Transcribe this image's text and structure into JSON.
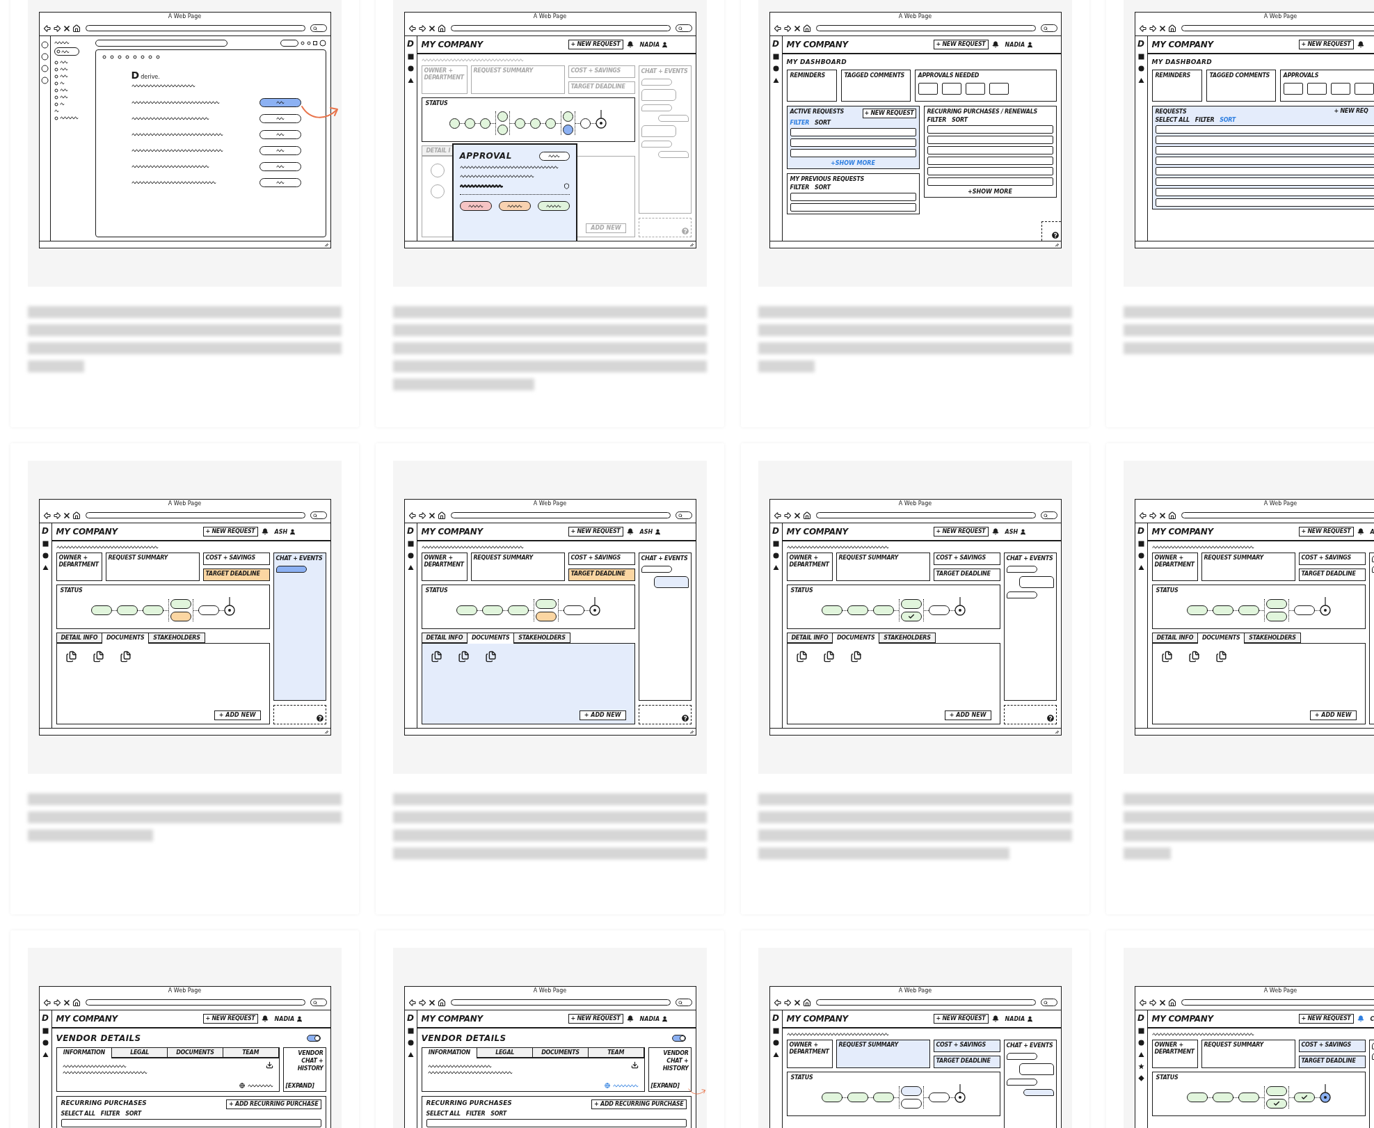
{
  "cards": [
    {
      "arrow": true,
      "wireframe": {
        "kind": "form",
        "page_title": "A Web Page",
        "logo_mark": "D",
        "logo_text": "derive.",
        "rows": [
          {
            "selected": true
          },
          {
            "selected": false
          },
          {
            "selected": false
          },
          {
            "selected": false
          },
          {
            "selected": false
          },
          {
            "selected": false
          }
        ]
      }
    },
    {
      "arrow": false,
      "wireframe": {
        "kind": "request",
        "page_title": "A Web Page",
        "app": {
          "logo": "D",
          "nav": [
            {
              "kind": "square"
            },
            {
              "kind": "circle"
            },
            {
              "kind": "triangle"
            }
          ],
          "company": "MY COMPANY",
          "new_request": "+ NEW REQUEST",
          "bell_active": false,
          "user": "NADIA"
        },
        "dimmed": true,
        "boxes": [
          {
            "kind": "owner",
            "label": "OWNER + DEPARTMENT",
            "color": "#ffffff"
          },
          {
            "kind": "summary",
            "label": "REQUEST SUMMARY",
            "color": "#ffffff"
          },
          {
            "kind": "cost",
            "label": "COST + SAVINGS",
            "color": "#ffffff"
          },
          {
            "kind": "target",
            "label": "TARGET DEADLINE",
            "color": "#ffffff"
          }
        ],
        "chat": {
          "label": "CHAT + EVENTS",
          "highlighted": false,
          "bubbles": [
            {
              "kind": "small",
              "right": false,
              "color": "#ffffff"
            },
            {
              "kind": "large",
              "right": false,
              "color": "#ffffff"
            },
            {
              "kind": "small",
              "right": false,
              "color": "#ffffff"
            },
            {
              "kind": "small",
              "right": true,
              "color": "#ffffff"
            },
            {
              "kind": "large",
              "right": false,
              "color": "#ffffff"
            },
            {
              "kind": "small",
              "right": false,
              "color": "#ffffff"
            },
            {
              "kind": "small",
              "right": true,
              "color": "#ffffff"
            }
          ]
        },
        "status": {
          "label": "STATUS",
          "kind": "circle",
          "steps": [
            {
              "nodes": [
                {
                  "kind": "done"
                }
              ]
            },
            {
              "nodes": [
                {
                  "kind": "done"
                }
              ]
            },
            {
              "nodes": [
                {
                  "kind": "done"
                }
              ]
            },
            {
              "nodes": [
                {
                  "kind": "done"
                },
                {
                  "kind": "done"
                }
              ]
            },
            {
              "nodes": [
                {
                  "kind": "done"
                }
              ]
            },
            {
              "nodes": [
                {
                  "kind": "done"
                }
              ]
            },
            {
              "nodes": [
                {
                  "kind": "done"
                }
              ]
            },
            {
              "nodes": [
                {
                  "kind": "done"
                },
                {
                  "kind": "active"
                }
              ]
            },
            {
              "nodes": [
                {
                  "kind": "todo"
                }
              ]
            }
          ],
          "final": {
            "active": false
          }
        },
        "lower": {
          "kind": "people",
          "highlighted": false,
          "tabs": [
            {
              "label": "DETAIL I",
              "selected": false
            }
          ],
          "add_button": "ADD NEW"
        },
        "help": true,
        "popup": {
          "title": "APPROVAL",
          "buttons": [
            {
              "color": "#f6c4c4"
            },
            {
              "color": "#f8d2b0"
            },
            {
              "color": "#e0f3dc"
            }
          ]
        }
      }
    },
    {
      "arrow": false,
      "wireframe": {
        "kind": "dashboard",
        "page_title": "A Web Page",
        "app": {
          "logo": "D",
          "nav": [
            {
              "kind": "square"
            },
            {
              "kind": "circle"
            },
            {
              "kind": "triangle"
            }
          ],
          "company": "MY COMPANY",
          "new_request": "+ NEW REQUEST",
          "bell_active": false,
          "user": "NADIA"
        },
        "title": "MY DASHBOARD",
        "tiles": [
          {
            "kind": "text",
            "label": "REMINDERS"
          },
          {
            "kind": "text",
            "label": "TAGGED COMMENTS"
          },
          {
            "kind": "slots",
            "label": "APPROVALS NEEDED"
          }
        ],
        "columns": [
          {
            "panels": [
              {
                "title": "ACTIVE REQUESTS",
                "highlight": true,
                "button": {
                  "label": "+ NEW REQUEST",
                  "outlined": true
                },
                "links": [
                  {
                    "label": "FILTER",
                    "active": true
                  },
                  {
                    "label": "SORT",
                    "active": false
                  }
                ],
                "kind": "medium",
                "show_more": "+SHOW MORE"
              },
              {
                "title": "MY PREVIOUS REQUESTS",
                "highlight": false,
                "links": [
                  {
                    "label": "FILTER",
                    "active": false
                  },
                  {
                    "label": "SORT",
                    "active": false
                  }
                ],
                "kind": "small"
              }
            ]
          },
          {
            "panels": [
              {
                "title": "RECURRING PURCHASES / RENEWALS",
                "highlight": false,
                "links": [
                  {
                    "label": "FILTER",
                    "active": false
                  },
                  {
                    "label": "SORT",
                    "active": false
                  }
                ],
                "kind": "large",
                "show_more": "+SHOW MORE"
              }
            ]
          }
        ],
        "help": true
      }
    },
    {
      "arrow": false,
      "wireframe": {
        "kind": "dashboard",
        "page_title": "A Web Page",
        "app": {
          "logo": "D",
          "nav": [
            {
              "kind": "square"
            },
            {
              "kind": "circle"
            },
            {
              "kind": "triangle"
            }
          ],
          "company": "MY COMPANY",
          "new_request": "+ NEW REQUEST",
          "bell_active": false
        },
        "title": "MY DASHBOARD",
        "tiles": [
          {
            "kind": "text",
            "label": "REMINDERS"
          },
          {
            "kind": "text",
            "label": "TAGGED COMMENTS"
          },
          {
            "kind": "slots",
            "label": "APPROVALS"
          }
        ],
        "columns": [
          {
            "panels": [
              {
                "title": "REQUESTS",
                "highlight": true,
                "button": {
                  "label": "+ NEW REQ",
                  "outlined": false
                },
                "links": [
                  {
                    "label": "SELECT ALL",
                    "active": false
                  },
                  {
                    "label": "FILTER",
                    "active": false
                  },
                  {
                    "label": "SORT",
                    "active": true
                  }
                ],
                "kind": "full"
              }
            ]
          }
        ],
        "help": false
      }
    },
    {
      "arrow": false,
      "wireframe": {
        "kind": "request",
        "page_title": "A Web Page",
        "app": {
          "logo": "D",
          "nav": [
            {
              "kind": "square"
            },
            {
              "kind": "circle"
            },
            {
              "kind": "triangle"
            }
          ],
          "company": "MY COMPANY",
          "new_request": "+ NEW REQUEST",
          "bell_active": false,
          "user": "ASH"
        },
        "dimmed": false,
        "boxes": [
          {
            "kind": "owner",
            "label": "OWNER + DEPARTMENT",
            "color": "#ffffff"
          },
          {
            "kind": "summary",
            "label": "REQUEST SUMMARY",
            "color": "#ffffff"
          },
          {
            "kind": "cost",
            "label": "COST + SAVINGS",
            "color": "#ffffff"
          },
          {
            "kind": "target",
            "label": "TARGET DEADLINE",
            "color": "#fbd6a2"
          }
        ],
        "chat": {
          "label": "CHAT + EVENTS",
          "highlighted": true,
          "bubbles": [
            {
              "kind": "small",
              "right": false,
              "color": "#8cb1f3"
            }
          ]
        },
        "status": {
          "label": "STATUS",
          "kind": "pill",
          "steps": [
            {
              "nodes": [
                {
                  "kind": "done"
                }
              ]
            },
            {
              "nodes": [
                {
                  "kind": "done"
                }
              ]
            },
            {
              "nodes": [
                {
                  "kind": "done"
                }
              ]
            },
            {
              "nodes": [
                {
                  "kind": "done"
                },
                {
                  "kind": "warning"
                }
              ]
            },
            {
              "nodes": [
                {
                  "kind": "todo"
                }
              ]
            }
          ],
          "final": {
            "active": false
          }
        },
        "lower": {
          "kind": "documents",
          "highlighted": false,
          "tabs": [
            {
              "label": "DETAIL INFO",
              "selected": false
            },
            {
              "label": "DOCUMENTS",
              "selected": true
            },
            {
              "label": "STAKEHOLDERS",
              "selected": false
            }
          ],
          "add_button": "+ ADD NEW"
        },
        "help": true
      }
    },
    {
      "arrow": false,
      "wireframe": {
        "kind": "request",
        "page_title": "A Web Page",
        "app": {
          "logo": "D",
          "nav": [
            {
              "kind": "square"
            },
            {
              "kind": "circle"
            },
            {
              "kind": "triangle"
            }
          ],
          "company": "MY COMPANY",
          "new_request": "+ NEW REQUEST",
          "bell_active": false,
          "user": "ASH"
        },
        "dimmed": false,
        "boxes": [
          {
            "kind": "owner",
            "label": "OWNER + DEPARTMENT",
            "color": "#ffffff"
          },
          {
            "kind": "summary",
            "label": "REQUEST SUMMARY",
            "color": "#ffffff"
          },
          {
            "kind": "cost",
            "label": "COST + SAVINGS",
            "color": "#ffffff"
          },
          {
            "kind": "target",
            "label": "TARGET DEADLINE",
            "color": "#fbd6a2"
          }
        ],
        "chat": {
          "label": "CHAT + EVENTS",
          "highlighted": false,
          "bubbles": [
            {
              "kind": "small",
              "right": false,
              "color": "#ffffff"
            },
            {
              "kind": "large",
              "right": true,
              "color": "#e4ecfb"
            }
          ]
        },
        "status": {
          "label": "STATUS",
          "kind": "pill",
          "steps": [
            {
              "nodes": [
                {
                  "kind": "done"
                }
              ]
            },
            {
              "nodes": [
                {
                  "kind": "done"
                }
              ]
            },
            {
              "nodes": [
                {
                  "kind": "done"
                }
              ]
            },
            {
              "nodes": [
                {
                  "kind": "done"
                },
                {
                  "kind": "warning"
                }
              ]
            },
            {
              "nodes": [
                {
                  "kind": "todo"
                }
              ]
            }
          ],
          "final": {
            "active": false
          }
        },
        "lower": {
          "kind": "documents",
          "highlighted": true,
          "tabs": [
            {
              "label": "DETAIL INFO",
              "selected": false
            },
            {
              "label": "DOCUMENTS",
              "selected": true
            },
            {
              "label": "STAKEHOLDERS",
              "selected": false
            }
          ],
          "add_button": "+ ADD NEW"
        },
        "help": true
      }
    },
    {
      "arrow": false,
      "wireframe": {
        "kind": "request",
        "page_title": "A Web Page",
        "app": {
          "logo": "D",
          "nav": [
            {
              "kind": "square"
            },
            {
              "kind": "circle"
            },
            {
              "kind": "triangle"
            }
          ],
          "company": "MY COMPANY",
          "new_request": "+ NEW REQUEST",
          "bell_active": false,
          "user": "ASH"
        },
        "dimmed": false,
        "boxes": [
          {
            "kind": "owner",
            "label": "OWNER + DEPARTMENT",
            "color": "#ffffff"
          },
          {
            "kind": "summary",
            "label": "REQUEST SUMMARY",
            "color": "#ffffff"
          },
          {
            "kind": "cost",
            "label": "COST + SAVINGS",
            "color": "#ffffff"
          },
          {
            "kind": "target",
            "label": "TARGET DEADLINE",
            "color": "#ffffff"
          }
        ],
        "chat": {
          "label": "CHAT + EVENTS",
          "highlighted": false,
          "bubbles": [
            {
              "kind": "small",
              "right": false,
              "color": "#ffffff"
            },
            {
              "kind": "large",
              "right": true,
              "color": "#ffffff"
            },
            {
              "kind": "small",
              "right": false,
              "color": "#ffffff"
            }
          ]
        },
        "status": {
          "label": "STATUS",
          "kind": "pill",
          "steps": [
            {
              "nodes": [
                {
                  "kind": "done"
                }
              ]
            },
            {
              "nodes": [
                {
                  "kind": "done"
                }
              ]
            },
            {
              "nodes": [
                {
                  "kind": "done"
                }
              ]
            },
            {
              "nodes": [
                {
                  "kind": "done"
                },
                {
                  "kind": "checked"
                }
              ]
            },
            {
              "nodes": [
                {
                  "kind": "todo"
                }
              ]
            }
          ],
          "final": {
            "active": false
          }
        },
        "lower": {
          "kind": "documents",
          "highlighted": false,
          "tabs": [
            {
              "label": "DETAIL INFO",
              "selected": false
            },
            {
              "label": "DOCUMENTS",
              "selected": true
            },
            {
              "label": "STAKEHOLDERS",
              "selected": false
            }
          ],
          "add_button": "+ ADD NEW"
        },
        "help": true
      }
    },
    {
      "arrow": false,
      "wireframe": {
        "kind": "request",
        "page_title": "A Web Page",
        "app": {
          "logo": "D",
          "nav": [
            {
              "kind": "square"
            },
            {
              "kind": "circle"
            },
            {
              "kind": "triangle"
            }
          ],
          "company": "MY COMPANY",
          "new_request": "+ NEW REQUEST",
          "bell_active": false,
          "user": "A"
        },
        "dimmed": false,
        "boxes": [
          {
            "kind": "owner",
            "label": "OWNER + DEPARTMENT",
            "color": "#ffffff"
          },
          {
            "kind": "summary",
            "label": "REQUEST SUMMARY",
            "color": "#ffffff"
          },
          {
            "kind": "cost",
            "label": "COST + SAVINGS",
            "color": "#ffffff"
          },
          {
            "kind": "target",
            "label": "TARGET DEADLINE",
            "color": "#ffffff"
          }
        ],
        "chat": {
          "highlighted": false,
          "bubbles": [
            {
              "kind": "small",
              "right": false,
              "color": "#ffffff"
            },
            {
              "kind": "small",
              "right": false,
              "color": "#ffffff"
            }
          ]
        },
        "status": {
          "label": "STATUS",
          "kind": "pill",
          "steps": [
            {
              "nodes": [
                {
                  "kind": "done"
                }
              ]
            },
            {
              "nodes": [
                {
                  "kind": "done"
                }
              ]
            },
            {
              "nodes": [
                {
                  "kind": "done"
                }
              ]
            },
            {
              "nodes": [
                {
                  "kind": "done"
                },
                {
                  "kind": "done"
                }
              ]
            },
            {
              "nodes": [
                {
                  "kind": "todo"
                }
              ]
            }
          ],
          "final": {
            "active": false
          }
        },
        "lower": {
          "kind": "documents",
          "highlighted": false,
          "tabs": [
            {
              "label": "DETAIL INFO",
              "selected": false
            },
            {
              "label": "DOCUMENTS",
              "selected": true
            },
            {
              "label": "STAKEHOLDERS",
              "selected": false
            }
          ],
          "add_button": "+ ADD NEW"
        },
        "help": false
      }
    },
    {
      "arrow": false,
      "wireframe": {
        "kind": "vendor",
        "page_title": "A Web Page",
        "app": {
          "logo": "D",
          "nav": [
            {
              "kind": "square"
            },
            {
              "kind": "circle"
            },
            {
              "kind": "triangle"
            }
          ],
          "company": "MY COMPANY",
          "new_request": "+ NEW REQUEST",
          "bell_active": false,
          "user": "NADIA"
        },
        "title": "VENDOR DETAILS",
        "toggle_on": true,
        "tabs": [
          {
            "label": "INFORMATION",
            "selected": true
          },
          {
            "label": "LEGAL",
            "selected": false
          },
          {
            "label": "DOCUMENTS",
            "selected": false
          },
          {
            "label": "TEAM",
            "selected": false
          }
        ],
        "link_active": false,
        "side_title": "VENDOR CHAT + HISTORY",
        "expand": "[EXPAND]",
        "section": {
          "title": "RECURRING PURCHASES",
          "button": "+ ADD RECURRING PURCHASE",
          "links": [
            {
              "label": "SELECT ALL",
              "active": false
            },
            {
              "label": "FILTER",
              "active": false
            },
            {
              "label": "SORT",
              "active": false
            }
          ]
        }
      }
    },
    {
      "arrow": true,
      "wireframe": {
        "kind": "vendor",
        "page_title": "A Web Page",
        "app": {
          "logo": "D",
          "nav": [
            {
              "kind": "square"
            },
            {
              "kind": "circle"
            },
            {
              "kind": "triangle"
            }
          ],
          "company": "MY COMPANY",
          "new_request": "+ NEW REQUEST",
          "bell_active": false,
          "user": "NADIA"
        },
        "title": "VENDOR DETAILS",
        "toggle_on": true,
        "tabs": [
          {
            "label": "INFORMATION",
            "selected": true
          },
          {
            "label": "LEGAL",
            "selected": false
          },
          {
            "label": "DOCUMENTS",
            "selected": false
          },
          {
            "label": "TEAM",
            "selected": false
          }
        ],
        "link_active": true,
        "side_title": "VENDOR CHAT + HISTORY",
        "expand": "[EXPAND]",
        "section": {
          "title": "RECURRING PURCHASES",
          "button": "+ ADD RECURRING PURCHASE",
          "links": [
            {
              "label": "SELECT ALL",
              "active": false
            },
            {
              "label": "FILTER",
              "active": false
            },
            {
              "label": "SORT",
              "active": false
            }
          ]
        }
      }
    },
    {
      "arrow": false,
      "wireframe": {
        "kind": "request",
        "page_title": "A Web Page",
        "app": {
          "logo": "D",
          "nav": [
            {
              "kind": "square"
            },
            {
              "kind": "circle"
            },
            {
              "kind": "triangle"
            }
          ],
          "company": "MY COMPANY",
          "new_request": "+ NEW REQUEST",
          "bell_active": false,
          "user": "NADIA"
        },
        "dimmed": false,
        "boxes": [
          {
            "kind": "owner",
            "label": "OWNER + DEPARTMENT",
            "color": "#ffffff"
          },
          {
            "kind": "summary",
            "label": "REQUEST SUMMARY",
            "color": "#e4ecfb"
          },
          {
            "kind": "cost",
            "label": "COST + SAVINGS",
            "color": "#e4ecfb"
          },
          {
            "kind": "target",
            "label": "TARGET DEADLINE",
            "color": "#e4ecfb"
          }
        ],
        "chat": {
          "label": "CHAT + EVENTS",
          "highlighted": false,
          "bubbles": [
            {
              "kind": "small",
              "right": false,
              "color": "#ffffff"
            },
            {
              "kind": "large",
              "right": true,
              "color": "#ffffff"
            },
            {
              "kind": "small",
              "right": false,
              "color": "#ffffff"
            },
            {
              "kind": "small",
              "right": true,
              "color": "#e4ecfb"
            }
          ]
        },
        "status": {
          "label": "STATUS",
          "kind": "pill",
          "steps": [
            {
              "nodes": [
                {
                  "kind": "done"
                }
              ]
            },
            {
              "nodes": [
                {
                  "kind": "done"
                }
              ]
            },
            {
              "nodes": [
                {
                  "kind": "done"
                }
              ]
            },
            {
              "nodes": [
                {
                  "kind": "highlight"
                },
                {
                  "kind": "todo"
                }
              ]
            },
            {
              "nodes": [
                {
                  "kind": "todo"
                }
              ]
            }
          ],
          "final": {
            "active": false
          }
        },
        "help": false
      }
    },
    {
      "arrow": false,
      "wireframe": {
        "kind": "request",
        "page_title": "A Web Page",
        "app": {
          "logo": "D",
          "nav": [
            {
              "kind": "square"
            },
            {
              "kind": "circle"
            },
            {
              "kind": "triangle"
            },
            {
              "kind": "star"
            },
            {
              "kind": "diamond"
            }
          ],
          "company": "MY COMPANY",
          "new_request": "+ NEW REQUEST",
          "bell_active": true,
          "user": "C"
        },
        "dimmed": false,
        "boxes": [
          {
            "kind": "owner",
            "label": "OWNER + DEPARTMENT",
            "color": "#ffffff"
          },
          {
            "kind": "summary",
            "label": "REQUEST SUMMARY",
            "color": "#ffffff"
          },
          {
            "kind": "cost",
            "label": "COST + SAVINGS",
            "color": "#e4ecfb"
          },
          {
            "kind": "target",
            "label": "TARGET DEADLINE",
            "color": "#e4ecfb"
          }
        ],
        "chat": {
          "highlighted": false,
          "bubbles": [
            {
              "kind": "small",
              "right": false,
              "color": "#ffffff"
            },
            {
              "kind": "small",
              "right": false,
              "color": "#ffffff"
            }
          ]
        },
        "status": {
          "label": "STATUS",
          "kind": "pill",
          "steps": [
            {
              "nodes": [
                {
                  "kind": "done"
                }
              ]
            },
            {
              "nodes": [
                {
                  "kind": "done"
                }
              ]
            },
            {
              "nodes": [
                {
                  "kind": "done"
                }
              ]
            },
            {
              "nodes": [
                {
                  "kind": "done"
                },
                {
                  "kind": "checked"
                }
              ]
            },
            {
              "nodes": [
                {
                  "kind": "checked"
                }
              ]
            }
          ],
          "final": {
            "active": true
          }
        },
        "help": false
      }
    }
  ]
}
